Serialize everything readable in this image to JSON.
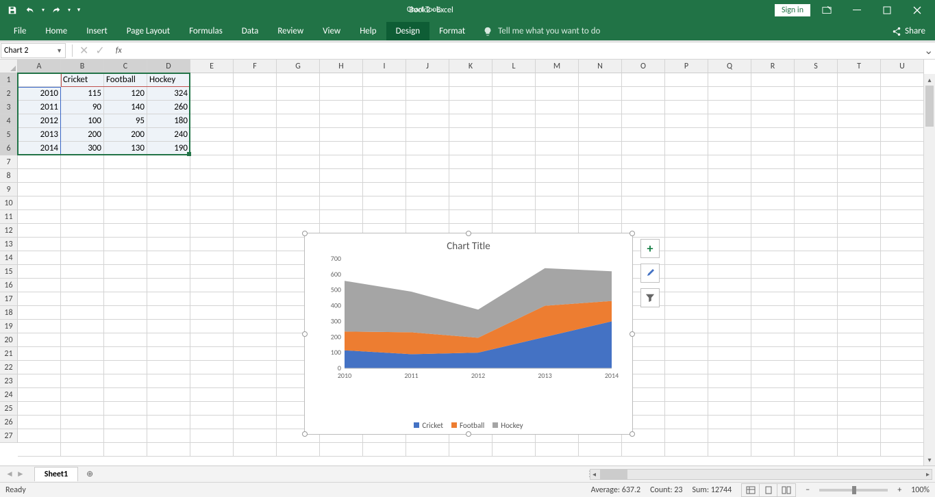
{
  "app": {
    "title": "Book2 - Excel",
    "chart_tools": "Chart Tools",
    "signin": "Sign in",
    "share": "Share"
  },
  "tabs": [
    "File",
    "Home",
    "Insert",
    "Page Layout",
    "Formulas",
    "Data",
    "Review",
    "View",
    "Help",
    "Design",
    "Format"
  ],
  "tellme": "Tell me what you want to do",
  "namebox": "Chart 2",
  "columns": [
    "A",
    "B",
    "C",
    "D",
    "E",
    "F",
    "G",
    "H",
    "I",
    "J",
    "K",
    "L",
    "M",
    "N",
    "O",
    "P",
    "Q",
    "R",
    "S",
    "T",
    "U"
  ],
  "rows": [
    "1",
    "2",
    "3",
    "4",
    "5",
    "6",
    "7",
    "8",
    "9",
    "10",
    "11",
    "12",
    "13",
    "14",
    "15",
    "16",
    "17",
    "18",
    "19",
    "20",
    "21",
    "22",
    "23",
    "24",
    "25",
    "26",
    "27"
  ],
  "headers": {
    "b1": "Cricket",
    "c1": "Football",
    "d1": "Hockey"
  },
  "cells": {
    "a2": "2010",
    "b2": "115",
    "c2": "120",
    "d2": "324",
    "a3": "2011",
    "b3": "90",
    "c3": "140",
    "d3": "260",
    "a4": "2012",
    "b4": "100",
    "c4": "95",
    "d4": "180",
    "a5": "2013",
    "b5": "200",
    "c5": "200",
    "d5": "240",
    "a6": "2014",
    "b6": "300",
    "c6": "130",
    "d6": "190"
  },
  "chart": {
    "title": "Chart Title"
  },
  "chart_data": {
    "type": "area",
    "stacked": true,
    "title": "Chart Title",
    "categories": [
      "2010",
      "2011",
      "2012",
      "2013",
      "2014"
    ],
    "series": [
      {
        "name": "Cricket",
        "color": "#4472C4",
        "values": [
          115,
          90,
          100,
          200,
          300
        ]
      },
      {
        "name": "Football",
        "color": "#ED7D31",
        "values": [
          120,
          140,
          95,
          200,
          130
        ]
      },
      {
        "name": "Hockey",
        "color": "#A5A5A5",
        "values": [
          324,
          260,
          180,
          240,
          190
        ]
      }
    ],
    "ylim": [
      0,
      700
    ],
    "yticks": [
      0,
      100,
      200,
      300,
      400,
      500,
      600,
      700
    ],
    "xlabel": "",
    "ylabel": ""
  },
  "sheet": {
    "name": "Sheet1"
  },
  "status": {
    "ready": "Ready",
    "avg": "Average: 637.2",
    "count": "Count: 23",
    "sum": "Sum: 12744",
    "zoom": "100%"
  }
}
